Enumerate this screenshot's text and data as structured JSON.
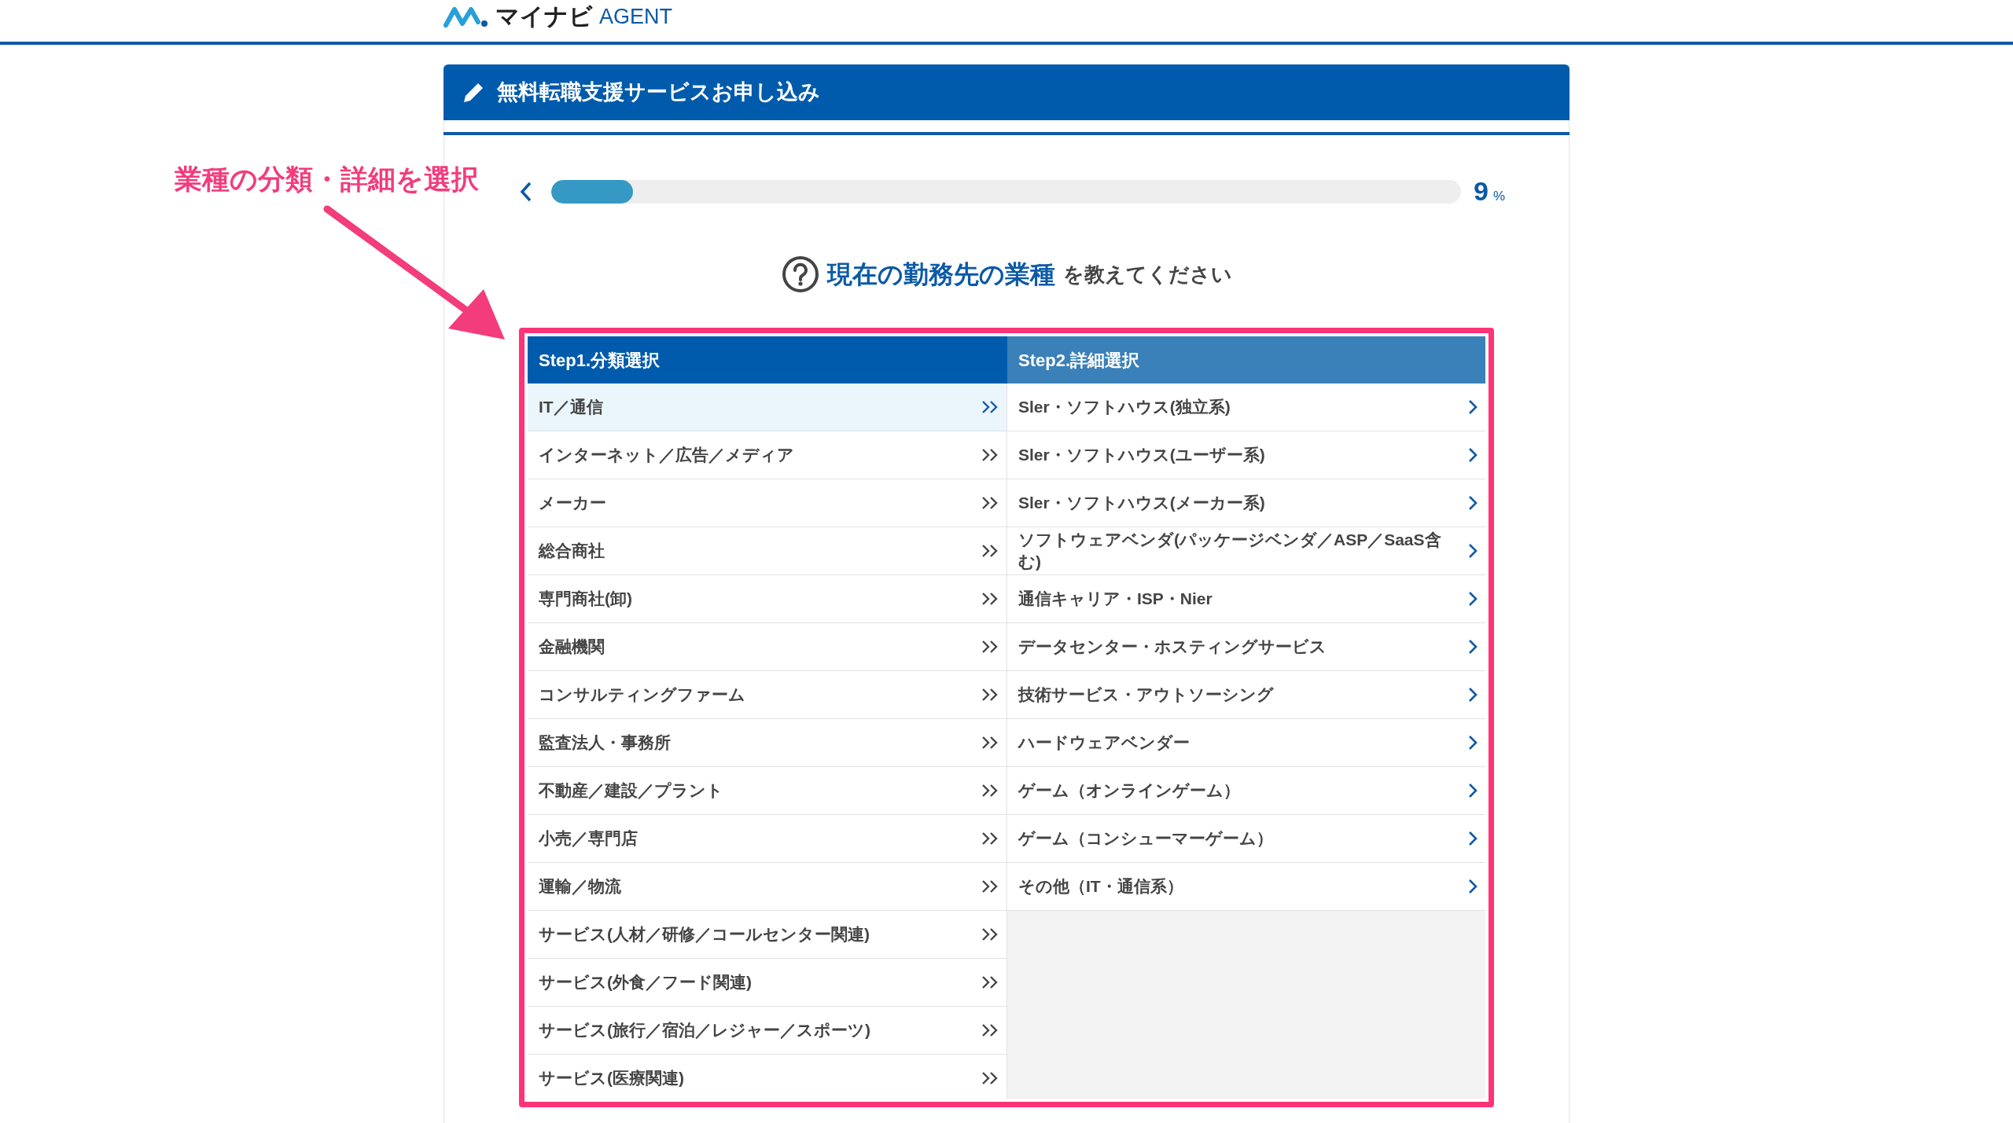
{
  "header": {
    "logo_text": "マイナビ",
    "logo_suffix": "AGENT"
  },
  "form_title": "無料転職支援サービスお申し込み",
  "annotation": "業種の分類・詳細を選択",
  "progress": {
    "level": 0.09,
    "reading": "9",
    "unit": "%"
  },
  "question": {
    "highlight": "現在の勤務先の業種",
    "rest": "を教えてください"
  },
  "step1": {
    "header": "Step1.分類選択",
    "items": [
      {
        "label": "IT／通信",
        "selected": true
      },
      {
        "label": "インターネット／広告／メディア",
        "selected": false
      },
      {
        "label": "メーカー",
        "selected": false
      },
      {
        "label": "総合商社",
        "selected": false
      },
      {
        "label": "専門商社(卸)",
        "selected": false
      },
      {
        "label": "金融機関",
        "selected": false
      },
      {
        "label": "コンサルティングファーム",
        "selected": false
      },
      {
        "label": "監査法人・事務所",
        "selected": false
      },
      {
        "label": "不動産／建設／プラント",
        "selected": false
      },
      {
        "label": "小売／専門店",
        "selected": false
      },
      {
        "label": "運輸／物流",
        "selected": false
      },
      {
        "label": "サービス(人材／研修／コールセンター関連)",
        "selected": false
      },
      {
        "label": "サービス(外食／フード関連)",
        "selected": false
      },
      {
        "label": "サービス(旅行／宿泊／レジャー／スポーツ)",
        "selected": false
      },
      {
        "label": "サービス(医療関連)",
        "selected": false
      }
    ]
  },
  "step2": {
    "header": "Step2.詳細選択",
    "items": [
      "Sler・ソフトハウス(独立系)",
      "Sler・ソフトハウス(ユーザー系)",
      "Sler・ソフトハウス(メーカー系)",
      "ソフトウェアベンダ(パッケージベンダ／ASP／SaaS含む)",
      "通信キャリア・ISP・Nier",
      "データセンター・ホスティングサービス",
      "技術サービス・アウトソーシング",
      "ハードウェアベンダー",
      "ゲーム（オンラインゲーム）",
      "ゲーム（コンシューマーゲーム）",
      "その他（IT・通信系）"
    ]
  }
}
